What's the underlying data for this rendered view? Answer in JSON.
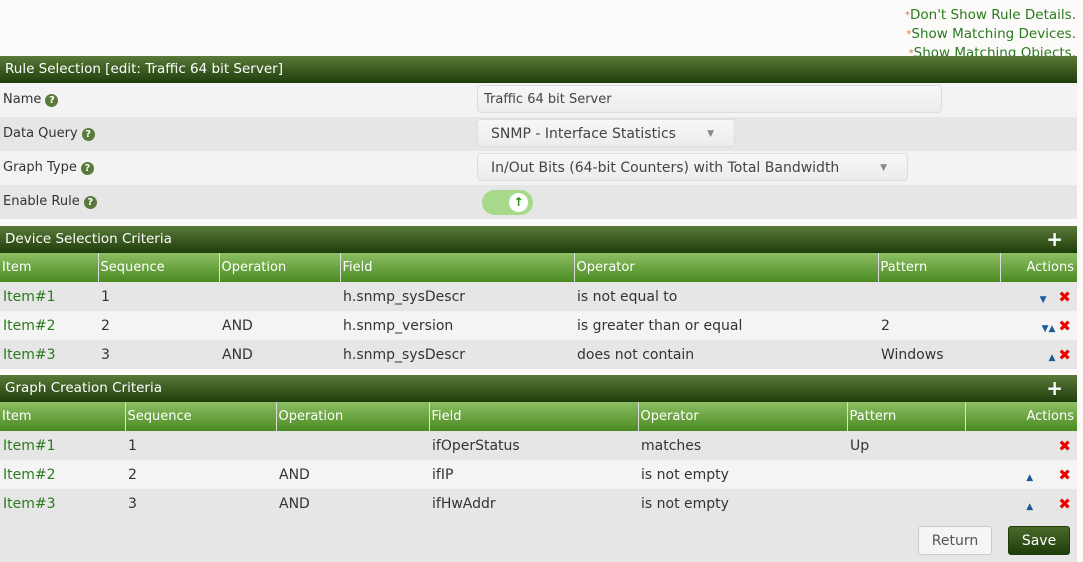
{
  "links": [
    "Don't Show Rule Details.",
    "Show Matching Devices.",
    "Show Matching Objects."
  ],
  "rule": {
    "title": "Rule Selection [edit: Traffic 64 bit Server]",
    "fields": {
      "name_label": "Name",
      "name_value": "Traffic 64 bit Server",
      "dq_label": "Data Query",
      "dq_value": "SNMP - Interface Statistics",
      "gt_label": "Graph Type",
      "gt_value": "In/Out Bits (64-bit Counters) with Total Bandwidth",
      "enable_label": "Enable Rule",
      "enabled": true
    }
  },
  "device": {
    "title": "Device Selection Criteria",
    "columns": [
      "Item",
      "Sequence",
      "Operation",
      "Field",
      "Operator",
      "Pattern",
      "Actions"
    ],
    "rows": [
      [
        "Item#1",
        "1",
        "",
        "h.snmp_sysDescr",
        "is not equal to",
        ""
      ],
      [
        "Item#2",
        "2",
        "AND",
        "h.snmp_version",
        "is greater than or equal",
        "2"
      ],
      [
        "Item#3",
        "3",
        "AND",
        "h.snmp_sysDescr",
        "does not contain",
        "Windows"
      ]
    ]
  },
  "graph": {
    "title": "Graph Creation Criteria",
    "columns": [
      "Item",
      "Sequence",
      "Operation",
      "Field",
      "Operator",
      "Pattern",
      "Actions"
    ],
    "rows": [
      [
        "Item#1",
        "1",
        "",
        "ifOperStatus",
        "matches",
        "Up"
      ],
      [
        "Item#2",
        "2",
        "AND",
        "ifIP",
        "is not empty",
        ""
      ],
      [
        "Item#3",
        "3",
        "AND",
        "ifHwAddr",
        "is not empty",
        ""
      ]
    ]
  },
  "buttons": {
    "return": "Return",
    "save": "Save"
  }
}
